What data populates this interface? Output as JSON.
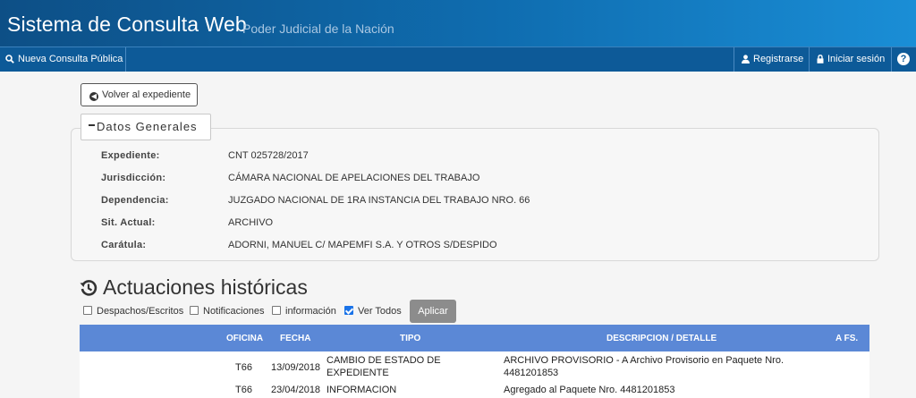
{
  "header": {
    "title": "Sistema de Consulta Web",
    "subtitle": "Poder Judicial de la Nación"
  },
  "nav": {
    "nueva_consulta": "Nueva Consulta Pública",
    "registrarse": "Registrarse",
    "iniciar_sesion": "Iniciar sesión",
    "help": "?"
  },
  "volver": "Volver al expediente",
  "datos": {
    "legend": "Datos Generales",
    "fields": [
      {
        "label": "Expediente:",
        "value": "CNT 025728/2017"
      },
      {
        "label": "Jurisdicción:",
        "value": "CÁMARA NACIONAL DE APELACIONES DEL TRABAJO"
      },
      {
        "label": "Dependencia:",
        "value": "JUZGADO NACIONAL DE 1RA INSTANCIA DEL TRABAJO NRO. 66"
      },
      {
        "label": "Sit. Actual:",
        "value": "ARCHIVO"
      },
      {
        "label": "Carátula:",
        "value": "ADORNI, MANUEL C/ MAPEMFI S.A. Y OTROS S/DESPIDO"
      }
    ]
  },
  "actuaciones": {
    "title": "Actuaciones históricas",
    "filters": [
      {
        "label": "Despachos/Escritos",
        "checked": false
      },
      {
        "label": "Notificaciones",
        "checked": false
      },
      {
        "label": "información",
        "checked": false
      },
      {
        "label": "Ver Todos",
        "checked": true
      }
    ],
    "apply": "Aplicar",
    "columns": {
      "oficina": "OFICINA",
      "fecha": "FECHA",
      "tipo": "TIPO",
      "descripcion": "DESCRIPCION / DETALLE",
      "afs": "A FS."
    },
    "rows": [
      {
        "oficina": "T66",
        "fecha": "13/09/2018",
        "tipo_1": "CAMBIO DE ESTADO DE",
        "tipo_2": "EXPEDIENTE",
        "desc_1": "ARCHIVO PROVISORIO - A Archivo Provisorio en Paquete Nro.",
        "desc_2": "4481201853"
      },
      {
        "oficina": "T66",
        "fecha": "23/04/2018",
        "tipo_1": "INFORMACION",
        "tipo_2": "",
        "desc_1": "Agregado al Paquete Nro. 4481201853",
        "desc_2": ""
      }
    ]
  }
}
